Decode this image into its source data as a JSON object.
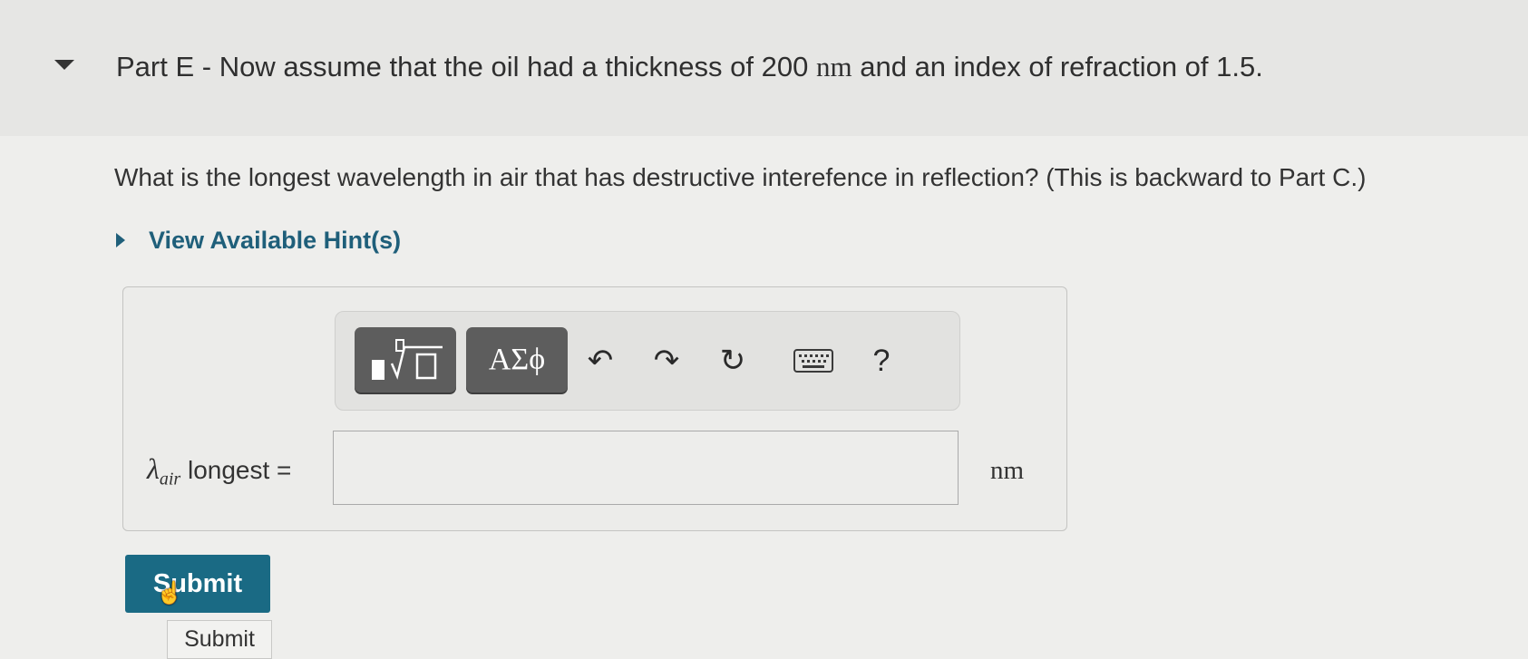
{
  "part": {
    "title_prefix": "Part E - Now assume that the oil had a thickness of 200",
    "title_unit": "nm",
    "title_suffix": "and an index of refraction of  1.5."
  },
  "question": "What is the longest wavelength in air that has destructive interefence in reflection? (This is backward to Part C.)",
  "hints": {
    "label": "View Available Hint(s)"
  },
  "toolbar": {
    "greek_label": "ΑΣϕ",
    "undo_icon": "↶",
    "redo_icon": "↷",
    "reset_icon": "↻",
    "help_label": "?"
  },
  "answer": {
    "symbol": "λ",
    "subscript": "air",
    "label_suffix": "longest =",
    "value": "",
    "unit": "nm"
  },
  "submit": {
    "label": "Submit",
    "tooltip": "Submit"
  }
}
